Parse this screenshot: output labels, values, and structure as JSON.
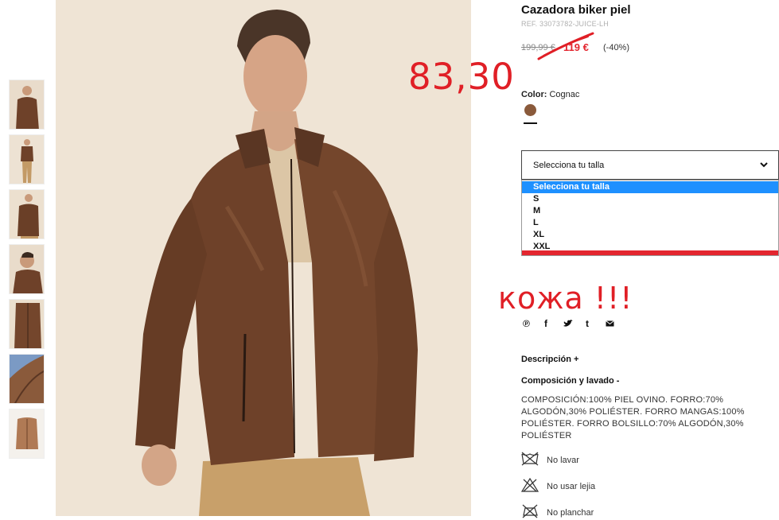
{
  "product": {
    "title": "Cazadora biker piel",
    "ref": "REF. 33073782-JUICE-LH",
    "old_price": "199,99 €",
    "new_price": "119 €",
    "discount": "(-40%)"
  },
  "annotations": {
    "handwritten_price": "83,30",
    "leather_note": "кожа !!!"
  },
  "color": {
    "label": "Color:",
    "value": "Cognac",
    "swatch_hex": "#8a5a3b"
  },
  "size_select": {
    "placeholder": "Selecciona tu talla",
    "options": [
      "Selecciona tu talla",
      "S",
      "M",
      "L",
      "XL",
      "XXL"
    ],
    "selected_index": 0
  },
  "share": {
    "icons": [
      "pinterest-icon",
      "facebook-icon",
      "twitter-icon",
      "tumblr-icon",
      "email-icon"
    ],
    "glyphs": [
      "℗",
      "f",
      "𝕥",
      "t",
      "✉"
    ]
  },
  "sections": {
    "description": "Descripción +",
    "composition_title": "Composición y lavado -",
    "composition_text": "COMPOSICIÓN:100% PIEL OVINO. FORRO:70% ALGODÓN,30% POLIÉSTER. FORRO MANGAS:100% POLIÉSTER. FORRO BOLSILLO:70% ALGODÓN,30% POLIÉSTER"
  },
  "care": [
    {
      "icon": "no-wash-icon",
      "label": "No lavar"
    },
    {
      "icon": "no-bleach-icon",
      "label": "No usar lejia"
    },
    {
      "icon": "no-iron-icon",
      "label": "No planchar"
    }
  ],
  "colors": {
    "accent_red": "#e3262f",
    "annotation_red": "#e01f26",
    "highlight_blue": "#1e90ff",
    "leather_brown": "#6e4129",
    "background_beige": "#efe4d5"
  }
}
